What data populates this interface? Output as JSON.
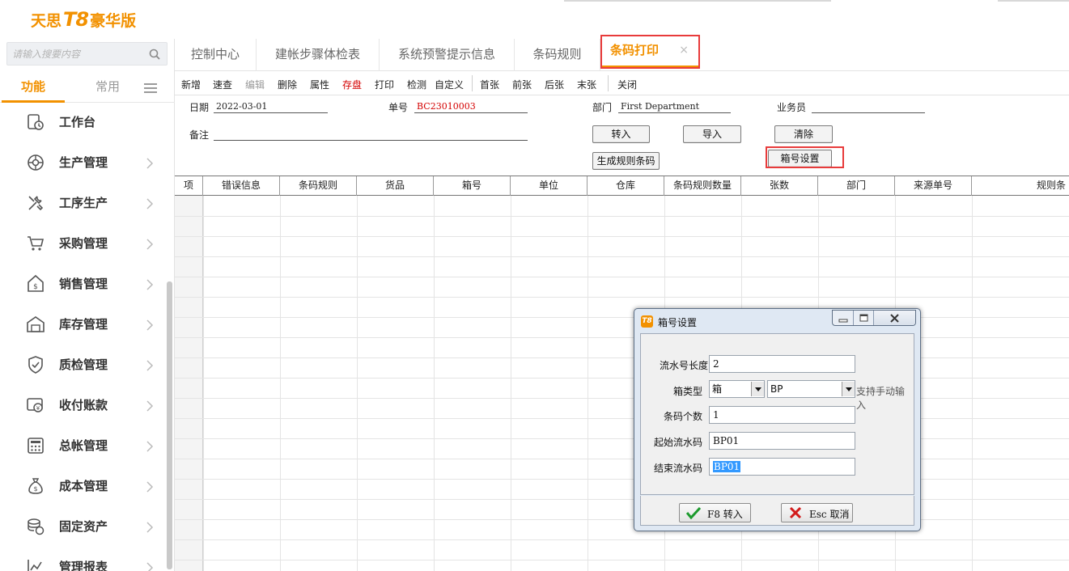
{
  "app": {
    "logo_brand": "天思",
    "logo_version": "T8",
    "logo_edition": "豪华版"
  },
  "sidebar": {
    "search_placeholder": "请输入搜要内容",
    "tabs": {
      "primary": "功能",
      "secondary": "常用"
    },
    "items": [
      {
        "label": "工作台",
        "icon": "clock-doc-icon",
        "chevron": false
      },
      {
        "label": "生产管理",
        "icon": "gear-globe-icon",
        "chevron": true
      },
      {
        "label": "工序生产",
        "icon": "tools-icon",
        "chevron": true
      },
      {
        "label": "采购管理",
        "icon": "cart-icon",
        "chevron": true
      },
      {
        "label": "销售管理",
        "icon": "sales-tag-icon",
        "chevron": true
      },
      {
        "label": "库存管理",
        "icon": "warehouse-icon",
        "chevron": true
      },
      {
        "label": "质检管理",
        "icon": "shield-check-icon",
        "chevron": true
      },
      {
        "label": "收付账款",
        "icon": "payment-icon",
        "chevron": true
      },
      {
        "label": "总帐管理",
        "icon": "calculator-icon",
        "chevron": true
      },
      {
        "label": "成本管理",
        "icon": "money-bag-icon",
        "chevron": true
      },
      {
        "label": "固定资产",
        "icon": "coins-stack-icon",
        "chevron": true
      },
      {
        "label": "管理报表",
        "icon": "line-chart-icon",
        "chevron": true
      }
    ]
  },
  "tabs": [
    {
      "label": "控制中心"
    },
    {
      "label": "建帐步骤体检表"
    },
    {
      "label": "系统预警提示信息"
    },
    {
      "label": "条码规则"
    },
    {
      "label": "条码打印",
      "active": true,
      "close": "×"
    }
  ],
  "toolbar": {
    "new": "新增",
    "quick": "速查",
    "edit": "编辑",
    "delete": "删除",
    "props": "属性",
    "save": "存盘",
    "print": "打印",
    "check": "检测",
    "custom": "自定义",
    "first": "首张",
    "prev": "前张",
    "next": "后张",
    "last": "末张",
    "close": "关闭"
  },
  "form": {
    "date_label": "日期",
    "date_value": "2022-03-01",
    "no_label": "单号",
    "no_value": "BC23010003",
    "dept_label": "部门",
    "dept_value": "First Department",
    "staff_label": "业务员",
    "staff_value": "",
    "remark_label": "备注",
    "remark_value": "",
    "btn_import_in": "转入",
    "btn_import": "导入",
    "btn_clear": "清除",
    "btn_generate": "生成规则条码",
    "btn_box_setting": "箱号设置"
  },
  "grid": {
    "columns": [
      "项",
      "错误信息",
      "条码规则",
      "货品",
      "箱号",
      "单位",
      "仓库",
      "条码规则数量",
      "张数",
      "部门",
      "来源单号",
      "规则条"
    ]
  },
  "dialog": {
    "title": "箱号设置",
    "serial_len_label": "流水号长度",
    "serial_len_value": "2",
    "box_type_label": "箱类型",
    "box_type_value": "箱",
    "box_prefix_value": "BP",
    "manual_hint": "支持手动输入",
    "count_label": "条码个数",
    "count_value": "1",
    "start_label": "起始流水码",
    "start_value": "BP01",
    "end_label": "结束流水码",
    "end_value": "BP01",
    "ok_button": "F8 转入",
    "cancel_button": "Esc 取消"
  },
  "colors": {
    "accent": "#f29100",
    "highlight_box": "#e83b3b",
    "red_text": "#d40000"
  }
}
